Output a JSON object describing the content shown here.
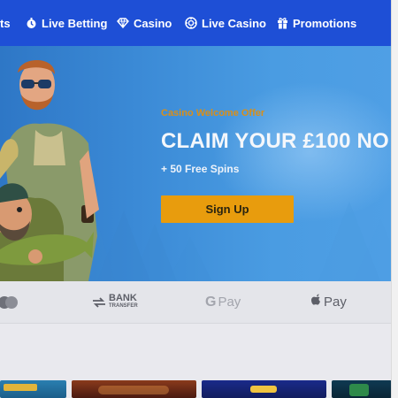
{
  "nav": {
    "items": [
      {
        "label": "ts",
        "icon": "none"
      },
      {
        "label": "Live Betting",
        "icon": "live-betting-icon"
      },
      {
        "label": "Casino",
        "icon": "diamond-icon"
      },
      {
        "label": "Live Casino",
        "icon": "roulette-chip-icon"
      },
      {
        "label": "Promotions",
        "icon": "gift-icon"
      }
    ],
    "background": "#1e4fd6"
  },
  "hero": {
    "offer_label": "Casino Welcome Offer",
    "title": "CLAIM YOUR £100 NO",
    "subtitle": "+ 50 Free Spins",
    "cta_label": "Sign Up",
    "accent": "#e89c0d"
  },
  "payments": {
    "bank_line1": "BANK",
    "bank_line2": "TRANSFER",
    "gpay_g": "G",
    "gpay_text": "Pay",
    "applepay_text": "Pay"
  },
  "games": [
    {
      "name": "game-1"
    },
    {
      "name": "game-2"
    },
    {
      "name": "game-3"
    },
    {
      "name": "game-4"
    }
  ]
}
